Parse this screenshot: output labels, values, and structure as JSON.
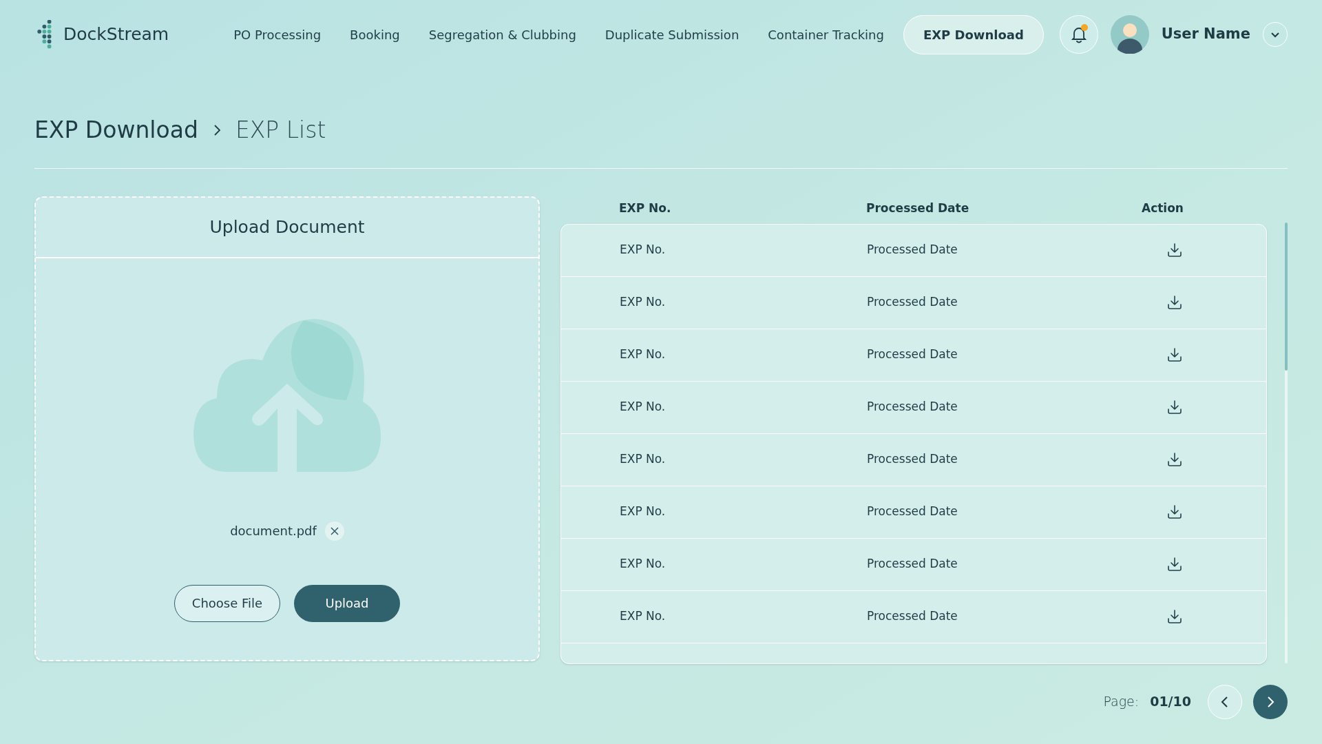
{
  "brand": {
    "name": "DockStream"
  },
  "nav": [
    {
      "label": "PO Processing",
      "selected": false
    },
    {
      "label": "Booking",
      "selected": false
    },
    {
      "label": "Segregation & Clubbing",
      "selected": false
    },
    {
      "label": "Duplicate Submission",
      "selected": false
    },
    {
      "label": "Container Tracking",
      "selected": false
    },
    {
      "label": "EXP Download",
      "selected": true
    }
  ],
  "notifications": {
    "unread": true
  },
  "user": {
    "name": "User Name"
  },
  "breadcrumb": [
    "EXP Download",
    "EXP List"
  ],
  "upload": {
    "title": "Upload Document",
    "file": "document.pdf",
    "buttons": [
      "Choose File",
      "Upload"
    ]
  },
  "table": {
    "columns": [
      "EXP No.",
      "Processed Date",
      "Action"
    ],
    "rows": [
      {
        "exp_no": "EXP No.",
        "processed_date": "Processed Date"
      },
      {
        "exp_no": "EXP No.",
        "processed_date": "Processed Date"
      },
      {
        "exp_no": "EXP No.",
        "processed_date": "Processed Date"
      },
      {
        "exp_no": "EXP No.",
        "processed_date": "Processed Date"
      },
      {
        "exp_no": "EXP No.",
        "processed_date": "Processed Date"
      },
      {
        "exp_no": "EXP No.",
        "processed_date": "Processed Date"
      },
      {
        "exp_no": "EXP No.",
        "processed_date": "Processed Date"
      },
      {
        "exp_no": "EXP No.",
        "processed_date": "Processed Date"
      }
    ]
  },
  "pagination": {
    "label": "Page:",
    "value": "01/10"
  }
}
